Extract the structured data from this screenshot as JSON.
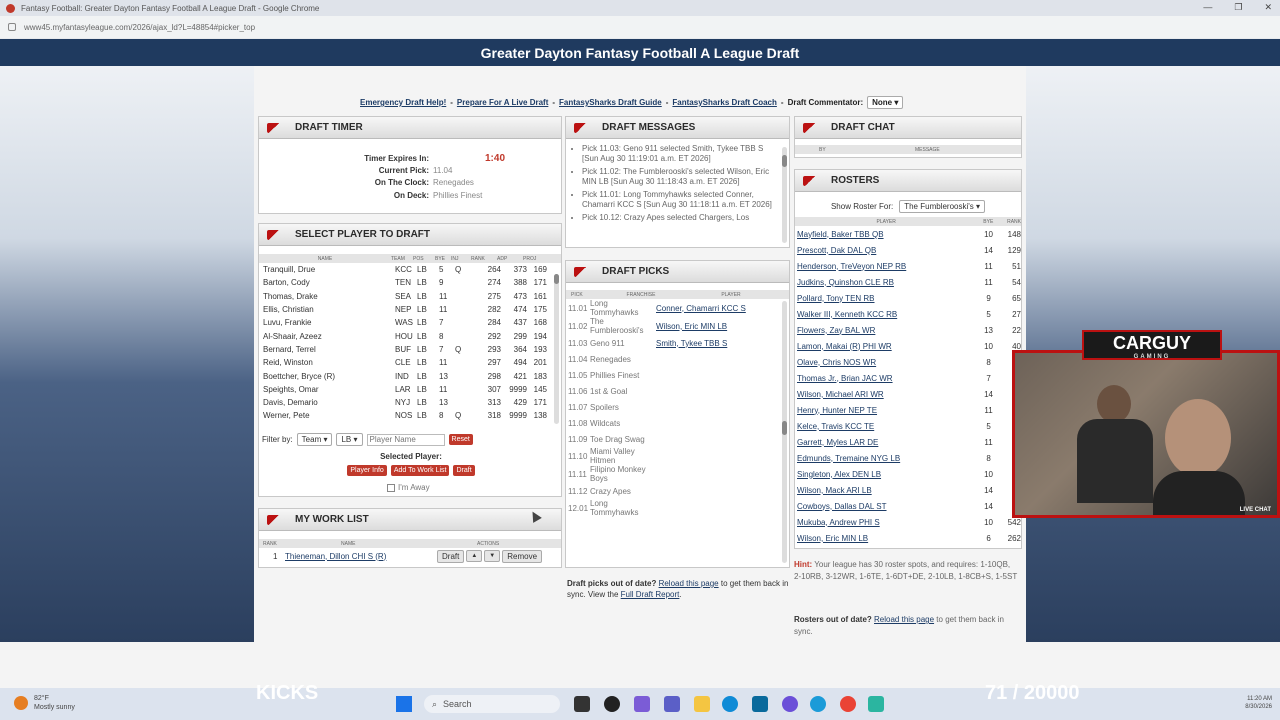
{
  "browser": {
    "title": "Fantasy Football: Greater Dayton Fantasy Football A League Draft - Google Chrome",
    "url": "www45.myfantasyleague.com/2026/ajax_ld?L=48854#picker_top"
  },
  "page": {
    "banner": "Greater Dayton Fantasy Football A League Draft",
    "links": [
      "Emergency Draft Help!",
      "Prepare For A Live Draft",
      "FantasySharks Draft Guide",
      "FantasySharks Draft Coach"
    ],
    "commentator_label": "Draft Commentator:",
    "commentator_value": "None"
  },
  "timer": {
    "title": "DRAFT TIMER",
    "expires_label": "Timer Expires In:",
    "expires_value": "1:40",
    "current_label": "Current Pick:",
    "current_value": "11.04",
    "clock_label": "On The Clock:",
    "clock_value": "Renegades",
    "deck_label": "On Deck:",
    "deck_value": "Phillies Finest"
  },
  "select_player": {
    "title": "SELECT PLAYER TO DRAFT",
    "headers": [
      "NAME",
      "TEAM",
      "POS",
      "BYE",
      "INJ",
      "RANK",
      "ADP",
      "PROJ"
    ],
    "rows": [
      [
        "Tranquill, Drue",
        "KCC",
        "LB",
        "5",
        "Q",
        "264",
        "373",
        "169"
      ],
      [
        "Barton, Cody",
        "TEN",
        "LB",
        "9",
        "",
        "274",
        "388",
        "171"
      ],
      [
        "Thomas, Drake",
        "SEA",
        "LB",
        "11",
        "",
        "275",
        "473",
        "161"
      ],
      [
        "Ellis, Christian",
        "NEP",
        "LB",
        "11",
        "",
        "282",
        "474",
        "175"
      ],
      [
        "Luvu, Frankie",
        "WAS",
        "LB",
        "7",
        "",
        "284",
        "437",
        "168"
      ],
      [
        "Al-Shaair, Azeez",
        "HOU",
        "LB",
        "8",
        "",
        "292",
        "299",
        "194"
      ],
      [
        "Bernard, Terrel",
        "BUF",
        "LB",
        "7",
        "Q",
        "293",
        "364",
        "193"
      ],
      [
        "Reid, Winston",
        "CLE",
        "LB",
        "11",
        "",
        "297",
        "494",
        "201"
      ],
      [
        "Boettcher, Bryce (R)",
        "IND",
        "LB",
        "13",
        "",
        "298",
        "421",
        "183"
      ],
      [
        "Speights, Omar",
        "LAR",
        "LB",
        "11",
        "",
        "307",
        "9999",
        "145"
      ],
      [
        "Davis, Demario",
        "NYJ",
        "LB",
        "13",
        "",
        "313",
        "429",
        "171"
      ],
      [
        "Werner, Pete",
        "NOS",
        "LB",
        "8",
        "Q",
        "318",
        "9999",
        "138"
      ]
    ],
    "filter_label": "Filter by:",
    "filter_team": "Team",
    "filter_pos": "LB",
    "player_name_placeholder": "Player Name",
    "reset": "Reset",
    "selected_label": "Selected Player:",
    "btn_info": "Player Info",
    "btn_worklist": "Add To Work List",
    "btn_draft": "Draft",
    "away": "I'm Away"
  },
  "work_list": {
    "title": "MY WORK LIST",
    "headers": [
      "RANK",
      "NAME",
      "ACTIONS"
    ],
    "rows": [
      {
        "rank": "1",
        "name": "Thieneman, Dillon CHI S (R)"
      }
    ],
    "btn_draft": "Draft",
    "btn_up": "▲",
    "btn_down": "▼",
    "btn_remove": "Remove"
  },
  "messages": {
    "title": "DRAFT MESSAGES",
    "items": [
      "Pick 11.03: Geno 911 selected Smith, Tykee TBB S [Sun Aug 30 11:19:01 a.m. ET 2026]",
      "Pick 11.02: The Fumblerooski's selected Wilson, Eric MIN LB [Sun Aug 30 11:18:43 a.m. ET 2026]",
      "Pick 11.01: Long Tommyhawks selected Conner, Chamarri KCC S [Sun Aug 30 11:18:11 a.m. ET 2026]",
      "Pick 10.12: Crazy Apes selected Chargers, Los"
    ]
  },
  "picks": {
    "title": "DRAFT PICKS",
    "headers": [
      "PICK",
      "FRANCHISE",
      "PLAYER"
    ],
    "rows": [
      {
        "pick": "11.01",
        "franchise": "Long Tommyhawks",
        "player": "Conner, Chamarri KCC S"
      },
      {
        "pick": "11.02",
        "franchise": "The Fumblerooski's",
        "player": "Wilson, Eric MIN LB"
      },
      {
        "pick": "11.03",
        "franchise": "Geno 911",
        "player": "Smith, Tykee TBB S"
      },
      {
        "pick": "11.04",
        "franchise": "Renegades",
        "player": ""
      },
      {
        "pick": "11.05",
        "franchise": "Phillies Finest",
        "player": ""
      },
      {
        "pick": "11.06",
        "franchise": "1st & Goal",
        "player": ""
      },
      {
        "pick": "11.07",
        "franchise": "Spoilers",
        "player": ""
      },
      {
        "pick": "11.08",
        "franchise": "Wildcats",
        "player": ""
      },
      {
        "pick": "11.09",
        "franchise": "Toe Drag Swag",
        "player": ""
      },
      {
        "pick": "11.10",
        "franchise": "Miami Valley Hitmen",
        "player": ""
      },
      {
        "pick": "11.11",
        "franchise": "Filipino Monkey Boys",
        "player": ""
      },
      {
        "pick": "11.12",
        "franchise": "Crazy Apes",
        "player": ""
      },
      {
        "pick": "12.01",
        "franchise": "Long Tommyhawks",
        "player": ""
      }
    ],
    "footer_pre": "Draft picks out of date?",
    "footer_link1": "Reload this page",
    "footer_mid": "to get them back in sync. View the",
    "footer_link2": "Full Draft Report",
    "footer_end": "."
  },
  "chat": {
    "title": "DRAFT CHAT",
    "headers": [
      "BY",
      "MESSAGE"
    ]
  },
  "rosters": {
    "title": "ROSTERS",
    "show_label": "Show Roster For:",
    "show_value": "The Fumblerooski's",
    "headers": [
      "PLAYER",
      "BYE",
      "RANK"
    ],
    "rows": [
      [
        "Mayfield, Baker TBB QB",
        "10",
        "148"
      ],
      [
        "Prescott, Dak DAL QB",
        "14",
        "129"
      ],
      [
        "Henderson, TreVeyon NEP RB",
        "11",
        "51"
      ],
      [
        "Judkins, Quinshon CLE RB",
        "11",
        "54"
      ],
      [
        "Pollard, Tony TEN RB",
        "9",
        "65"
      ],
      [
        "Walker III, Kenneth KCC RB",
        "5",
        "27"
      ],
      [
        "Flowers, Zay BAL WR",
        "13",
        "22"
      ],
      [
        "Lamon, Makai (R) PHI WR",
        "10",
        "40"
      ],
      [
        "Olave, Chris NOS WR",
        "8",
        ""
      ],
      [
        "Thomas Jr., Brian JAC WR",
        "7",
        ""
      ],
      [
        "Wilson, Michael ARI WR",
        "14",
        ""
      ],
      [
        "Henry, Hunter NEP TE",
        "11",
        ""
      ],
      [
        "Kelce, Travis KCC TE",
        "5",
        ""
      ],
      [
        "Garrett, Myles LAR DE",
        "11",
        ""
      ],
      [
        "Edmunds, Tremaine NYG LB",
        "8",
        ""
      ],
      [
        "Singleton, Alex DEN LB",
        "10",
        ""
      ],
      [
        "Wilson, Mack ARI LB",
        "14",
        ""
      ],
      [
        "Cowboys, Dallas DAL ST",
        "14",
        ""
      ],
      [
        "Mukuba, Andrew PHI S",
        "10",
        "542"
      ],
      [
        "Wilson, Eric MIN LB",
        "6",
        "262"
      ]
    ],
    "hint_label": "Hint:",
    "hint_text": "Your league has 30 roster spots, and requires: 1-10QB, 2-10RB, 3-12WR, 1-6TE, 1-6DT+DE, 2-10LB, 1-8CB+S, 1-5ST",
    "footer_pre": "Rosters out of date?",
    "footer_link": "Reload this page",
    "footer_end": "to get them back in sync."
  },
  "overlay": {
    "logo": "CARGUY",
    "logo_sub": "GAMING",
    "live_chat": "LIVE CHAT",
    "left_stat": "KICKS",
    "right_stat": "71 / 20000"
  },
  "taskbar": {
    "weather_temp": "82°F",
    "weather_text": "Mostly sunny",
    "search": "Search",
    "time": "11:20 AM",
    "date": "8/30/2026"
  },
  "colors": {
    "banner": "#1f3a5f",
    "accent_red": "#c0392b",
    "link": "#1d3c66"
  }
}
